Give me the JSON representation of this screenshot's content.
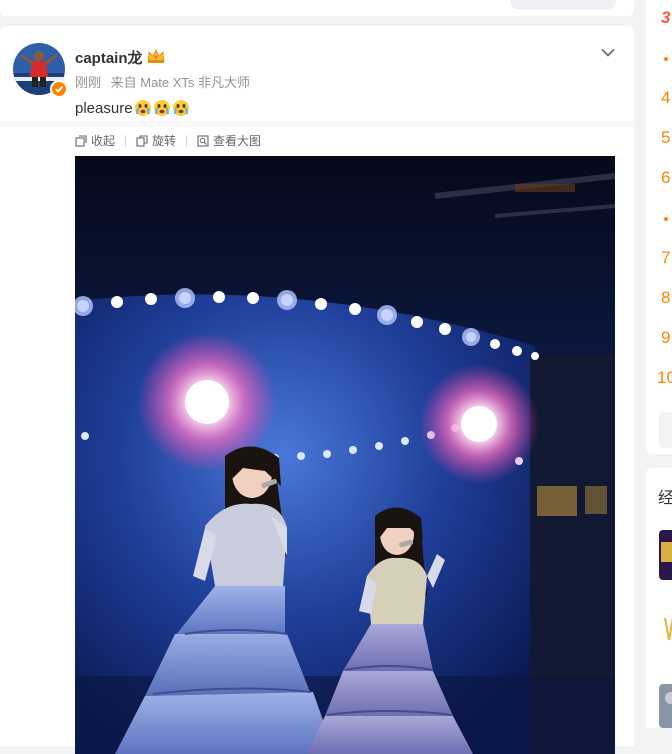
{
  "post": {
    "username": "captain龙",
    "time": "刚刚",
    "source": "来自 Mate XTs 非凡大师",
    "text": "pleasure",
    "tools": {
      "collapse": "收起",
      "rotate": "旋转",
      "view_large": "查看大图"
    }
  },
  "sidebar": {
    "ranks": [
      "3",
      "4",
      "5",
      "6",
      "7",
      "8",
      "9",
      "10"
    ],
    "section_title": "经"
  },
  "colors": {
    "accent": "#ff8200",
    "rank_top": "#ff5a3a",
    "text": "#333333",
    "meta": "#939393",
    "background": "#f2f3f5"
  },
  "icons": [
    "crown-icon",
    "chevron-down-icon",
    "collapse-icon",
    "rotate-icon",
    "view-large-icon",
    "verified-badge-icon",
    "crying-face-emoji"
  ]
}
